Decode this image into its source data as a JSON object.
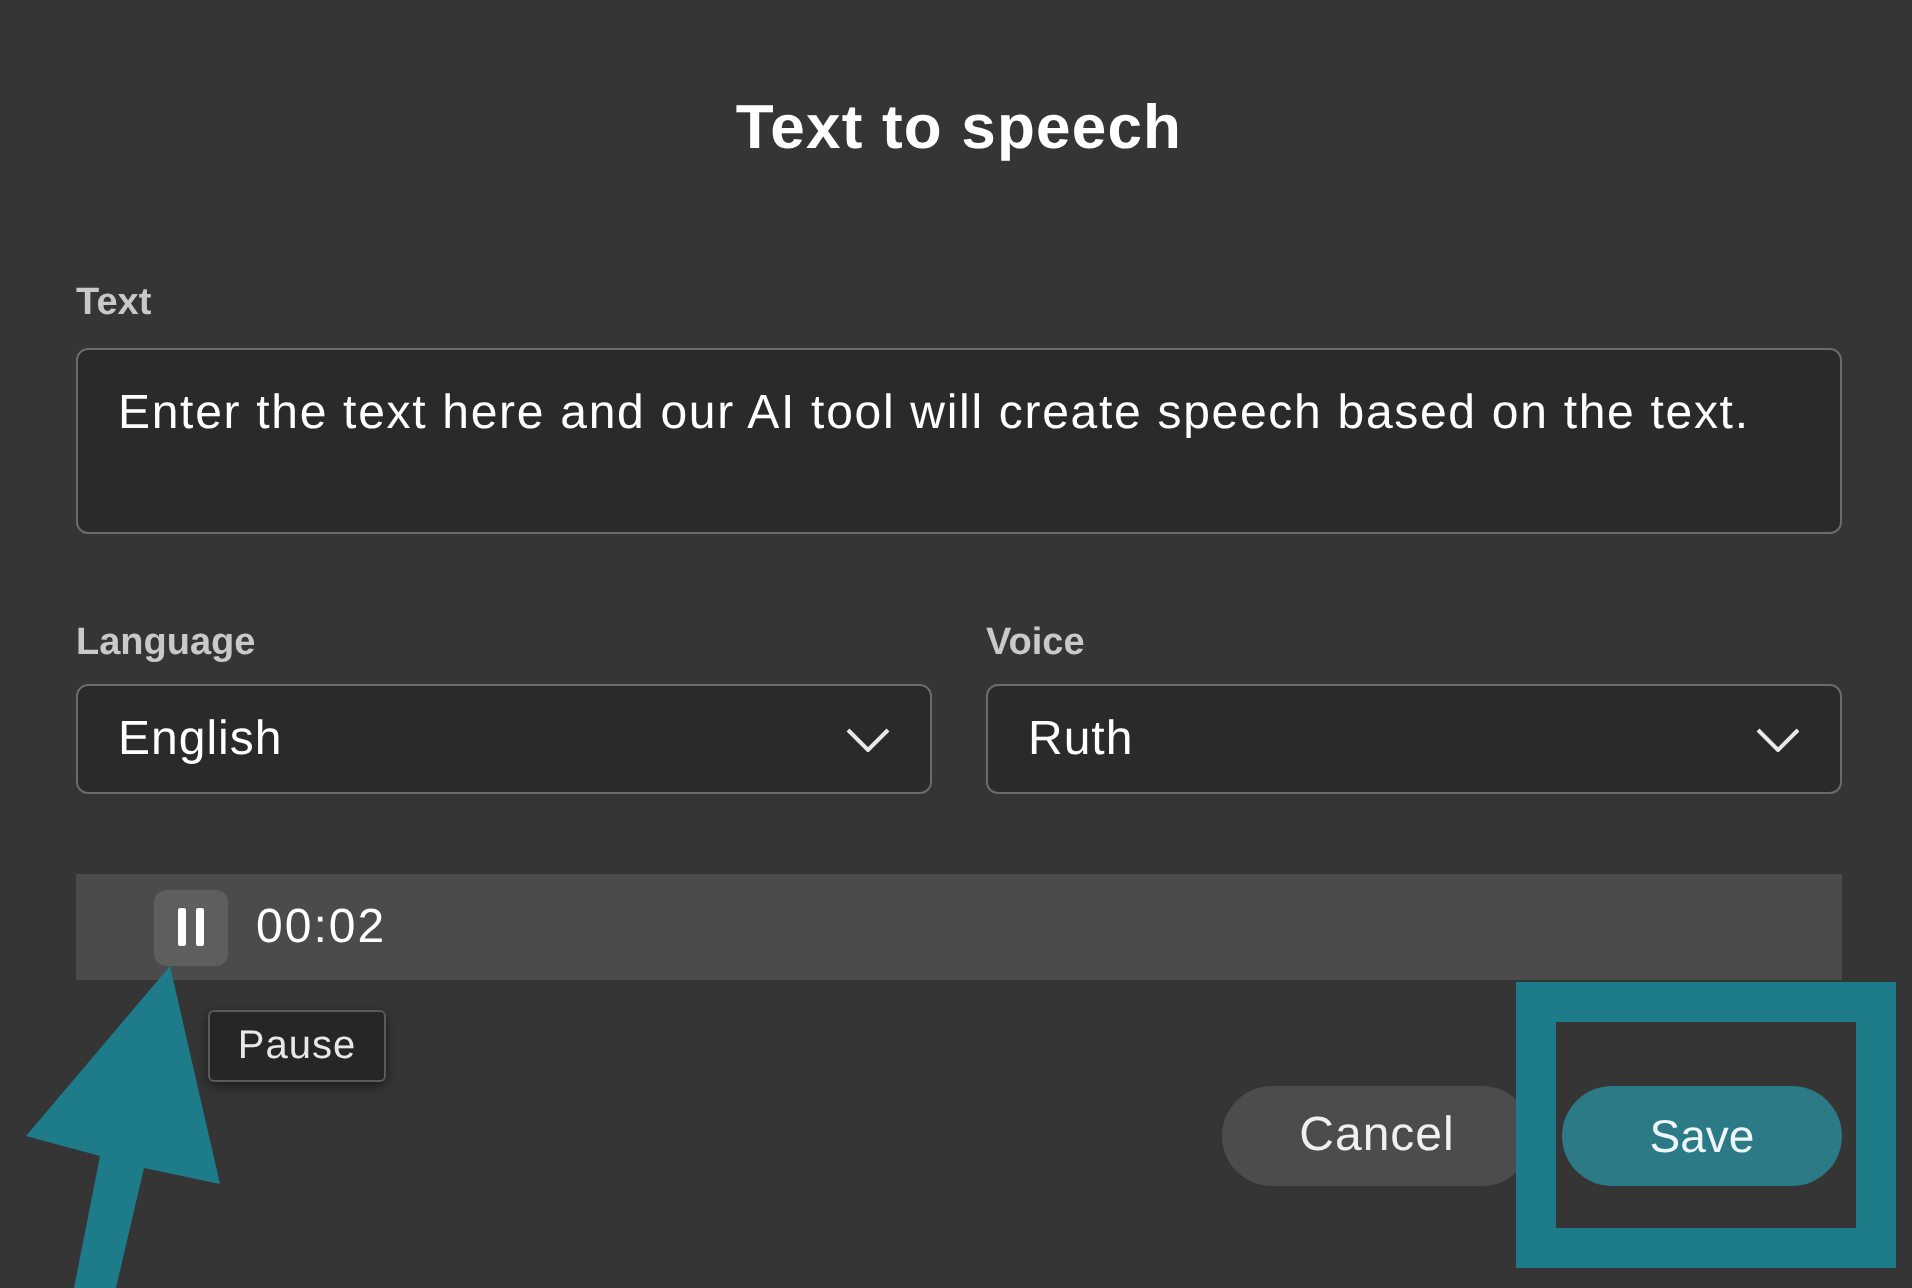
{
  "dialog": {
    "title": "Text to speech"
  },
  "text_field": {
    "label": "Text",
    "value": "Enter the text here and our AI tool will create speech based on the text."
  },
  "selects": [
    {
      "label": "Language",
      "value": "English"
    },
    {
      "label": "Voice",
      "value": "Ruth"
    }
  ],
  "player": {
    "playing": true,
    "time": "00:02",
    "tooltip": "Pause"
  },
  "buttons": [
    {
      "label": "Cancel",
      "kind": "secondary"
    },
    {
      "label": "Save",
      "kind": "primary"
    }
  ],
  "annotations": {
    "pointer_arrow": true,
    "highlight_frame": true
  }
}
